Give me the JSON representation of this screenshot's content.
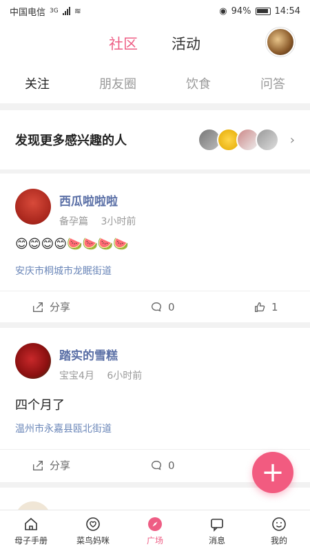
{
  "status": {
    "carrier": "中国电信",
    "network": "3G",
    "battery": "94%",
    "time": "14:54"
  },
  "header": {
    "tabs": [
      "社区",
      "活动"
    ],
    "active_tab": "社区"
  },
  "subtabs": [
    "关注",
    "朋友圈",
    "饮食",
    "问答"
  ],
  "discover": {
    "title": "发现更多感兴趣的人"
  },
  "posts": [
    {
      "name": "西瓜啦啦啦",
      "stage": "备孕篇",
      "time": "3小时前",
      "content": "😊😊😊😊🍉🍉🍉🍉",
      "location": "安庆市桐城市龙眠街道",
      "share": "分享",
      "comments": "0",
      "likes": "1"
    },
    {
      "name": "踏实的雪糕",
      "stage": "宝宝4月",
      "time": "6小时前",
      "content": "四个月了",
      "location": "温州市永嘉县瓯北街道",
      "share": "分享",
      "comments": "0"
    }
  ],
  "bottom_nav": [
    {
      "label": "母子手册",
      "icon": "home-icon"
    },
    {
      "label": "菜鸟妈咪",
      "icon": "heart-chat-icon"
    },
    {
      "label": "广场",
      "icon": "compass-icon"
    },
    {
      "label": "消息",
      "icon": "message-icon"
    },
    {
      "label": "我的",
      "icon": "profile-icon"
    }
  ],
  "accent_color": "#ee5d84"
}
